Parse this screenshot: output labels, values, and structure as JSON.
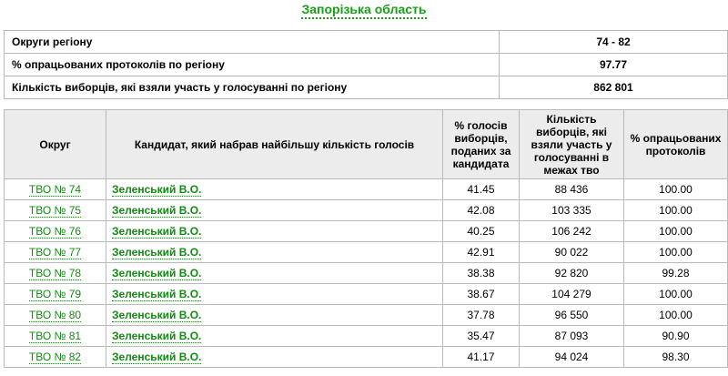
{
  "region": {
    "title": "Запорізька область"
  },
  "summary": [
    {
      "label": "Округи регіону",
      "value": "74 - 82"
    },
    {
      "label": "% опрацьованих протоколів по регіону",
      "value": "97.77"
    },
    {
      "label": "Кількість виборців, які взяли участь у голосуванні по регіону",
      "value": "862 801"
    }
  ],
  "table": {
    "headers": {
      "district": "Округ",
      "candidate": "Кандидат, який набрав найбільшу кількість голосів",
      "votes_pct": "% голосів виборців, поданих за кандидата",
      "turnout": "Кількість виборців, які взяли участь у голосуванні в межах тво",
      "processed": "% опрацьованих протоколів"
    },
    "rows": [
      {
        "district": "ТВО № 74",
        "candidate": "Зеленський В.О.",
        "votes_pct": "41.45",
        "turnout": "88 436",
        "processed": "100.00"
      },
      {
        "district": "ТВО № 75",
        "candidate": "Зеленський В.О.",
        "votes_pct": "42.08",
        "turnout": "103 335",
        "processed": "100.00"
      },
      {
        "district": "ТВО № 76",
        "candidate": "Зеленський В.О.",
        "votes_pct": "40.25",
        "turnout": "106 242",
        "processed": "100.00"
      },
      {
        "district": "ТВО № 77",
        "candidate": "Зеленський В.О.",
        "votes_pct": "42.91",
        "turnout": "90 022",
        "processed": "100.00"
      },
      {
        "district": "ТВО № 78",
        "candidate": "Зеленський В.О.",
        "votes_pct": "38.38",
        "turnout": "92 820",
        "processed": "99.28"
      },
      {
        "district": "ТВО № 79",
        "candidate": "Зеленський В.О.",
        "votes_pct": "38.67",
        "turnout": "104 279",
        "processed": "100.00"
      },
      {
        "district": "ТВО № 80",
        "candidate": "Зеленський В.О.",
        "votes_pct": "37.78",
        "turnout": "96 550",
        "processed": "100.00"
      },
      {
        "district": "ТВО № 81",
        "candidate": "Зеленський В.О.",
        "votes_pct": "35.47",
        "turnout": "87 093",
        "processed": "90.90"
      },
      {
        "district": "ТВО № 82",
        "candidate": "Зеленський В.О.",
        "votes_pct": "41.17",
        "turnout": "94 024",
        "processed": "98.30"
      }
    ]
  },
  "colors": {
    "link": "#138a13",
    "title": "#17a117",
    "header_bg": "#ececec",
    "border": "#b9b9b9"
  }
}
